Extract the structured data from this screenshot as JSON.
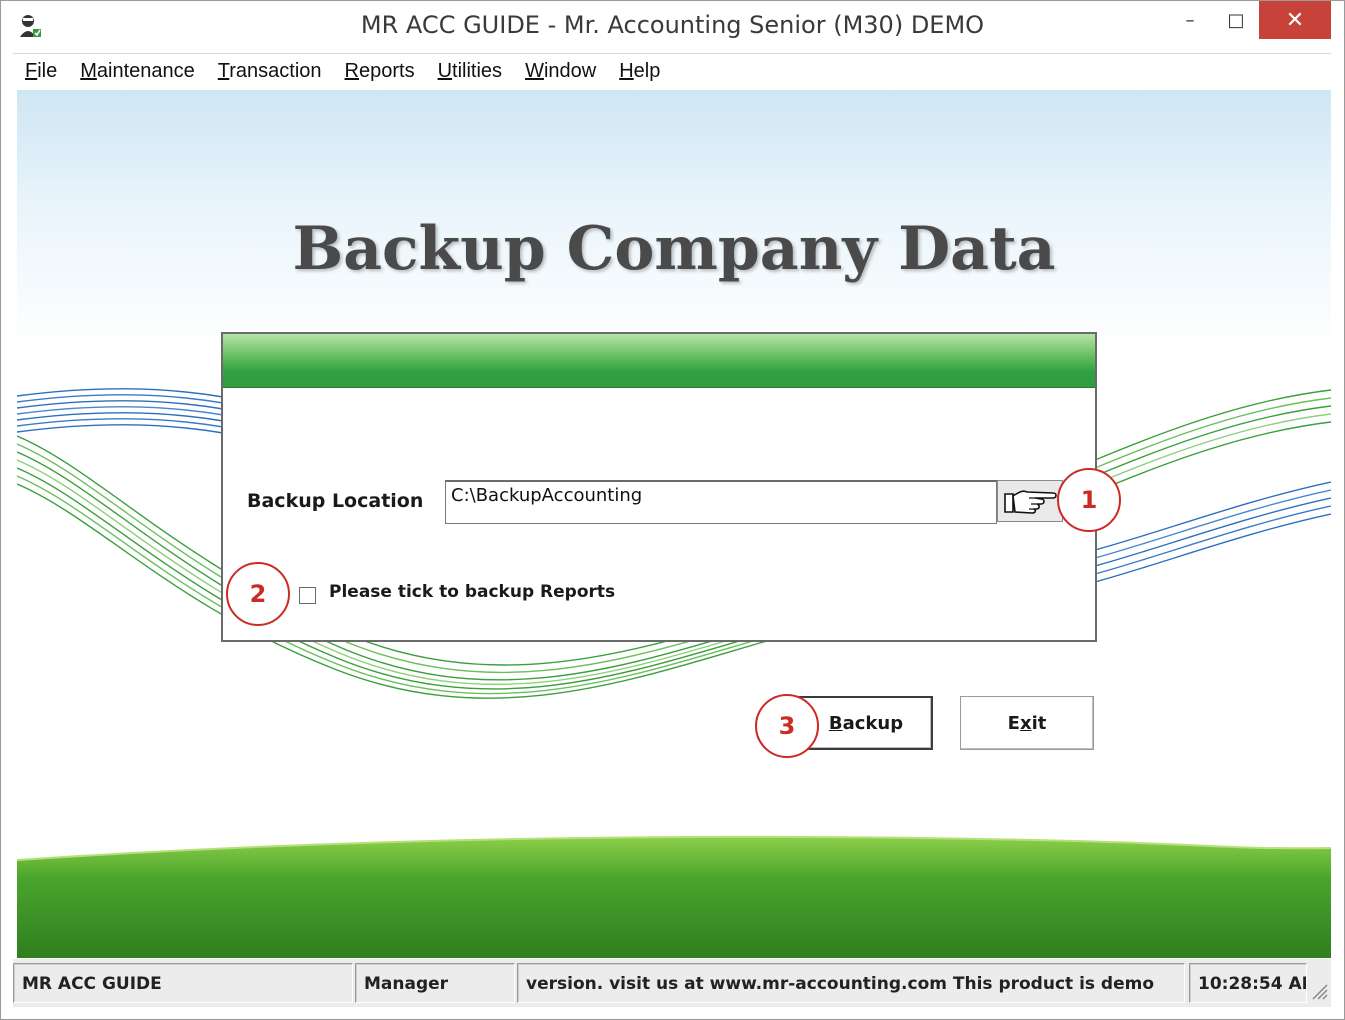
{
  "window": {
    "title": "MR ACC GUIDE - Mr. Accounting Senior (M30) DEMO",
    "controls": {
      "minimize": "–",
      "maximize": "□",
      "close": "✕"
    }
  },
  "menu": {
    "items": [
      {
        "key": "F",
        "rest": "ile"
      },
      {
        "key": "M",
        "rest": "aintenance"
      },
      {
        "key": "T",
        "rest": "ransaction"
      },
      {
        "key": "R",
        "rest": "eports"
      },
      {
        "key": "U",
        "rest": "tilities"
      },
      {
        "key": "W",
        "rest": "indow"
      },
      {
        "key": "H",
        "rest": "elp"
      }
    ]
  },
  "page": {
    "title": "Backup Company Data"
  },
  "form": {
    "backup_location_label": "Backup Location",
    "backup_location_value": "C:\\BackupAccounting",
    "browse_icon": "pointing-hand-icon",
    "reports_checkbox_label": "Please tick to backup Reports",
    "reports_checkbox_checked": false
  },
  "buttons": {
    "backup": {
      "key": "B",
      "rest": "ackup"
    },
    "exit": {
      "pre": "E",
      "key": "x",
      "rest": "it"
    }
  },
  "markers": [
    "1",
    "2",
    "3"
  ],
  "status": {
    "app": "MR ACC GUIDE",
    "user": "Manager",
    "message": "version.  visit us at www.mr-accounting.com This product is demo",
    "time": "10:28:54 AI"
  },
  "colors": {
    "header_green": "#32a243",
    "marker_red": "#cc2a24",
    "close_red": "#c7433a"
  }
}
